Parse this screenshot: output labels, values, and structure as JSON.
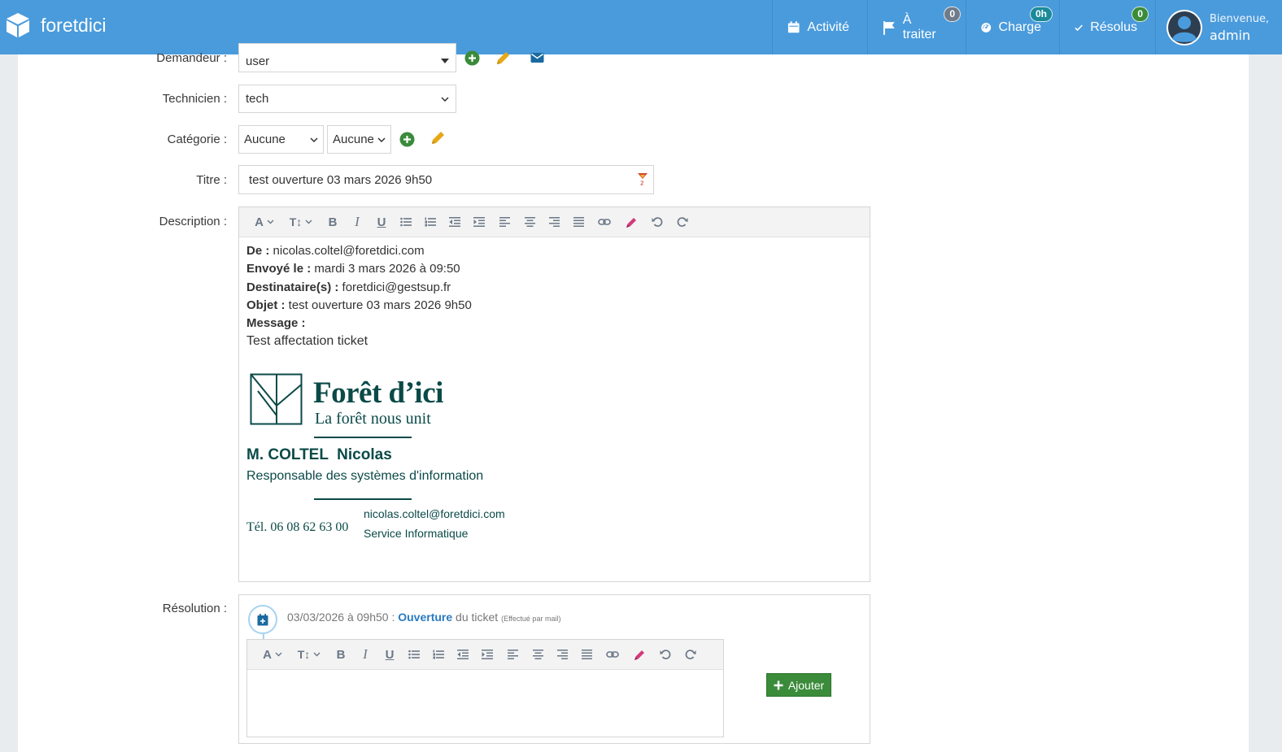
{
  "navbar": {
    "brand": "foretdici",
    "items": [
      {
        "label": "Activité",
        "icon": "calendar-icon",
        "badge": ""
      },
      {
        "label": "À traiter",
        "icon": "flag-icon",
        "badge": "0",
        "badge_color": "#6f7b8a"
      },
      {
        "label": "Charge",
        "icon": "dashboard-icon",
        "badge": "0h",
        "badge_color": "#1a8a9a"
      },
      {
        "label": "Résolus",
        "icon": "check-icon",
        "badge": "0",
        "badge_color": "#3a8b3a"
      }
    ],
    "user": {
      "greeting": "Bienvenue,",
      "name": "admin"
    }
  },
  "form": {
    "demandeur": {
      "label": "Demandeur :",
      "value": "user"
    },
    "technicien": {
      "label": "Technicien :",
      "value": "tech"
    },
    "categorie": {
      "label": "Catégorie :",
      "value1": "Aucune",
      "value2": "Aucune"
    },
    "titre": {
      "label": "Titre :",
      "value": "test ouverture 03 mars 2026 9h50"
    },
    "description": {
      "label": "Description :",
      "from_label": "De :",
      "from_value": "nicolas.coltel@foretdici.com",
      "sent_label": "Envoyé le :",
      "sent_value": "mardi 3 mars 2026 à 09:50",
      "to_label": "Destinataire(s) :",
      "to_value": "foretdici@gestsup.fr",
      "subject_label": "Objet :",
      "subject_value": "test ouverture 03 mars 2026 9h50",
      "message_label": "Message :",
      "message_text": "Test affectation ticket"
    },
    "signature": {
      "logo_title": "Forêt d’ici",
      "logo_tagline": "La forêt nous unit",
      "name": "M. COLTEL  Nicolas",
      "role": "Responsable des systèmes d'information",
      "tel": "Tél. 06 08 62 63 00",
      "email": "nicolas.coltel@foretdici.com",
      "service": "Service Informatique"
    },
    "resolution": {
      "label": "Résolution :",
      "event_date": "03/03/2026 à 09h50 :",
      "event_action": "Ouverture",
      "event_suffix": "du ticket",
      "event_note": "(Effectué par mail)",
      "add_button": "Ajouter"
    }
  },
  "colors": {
    "navbar": "#4a9bdc",
    "accent_green": "#3a8b3a",
    "pencil": "#e6a817",
    "signature": "#0a4a48",
    "link_blue": "#2a7ac0"
  }
}
